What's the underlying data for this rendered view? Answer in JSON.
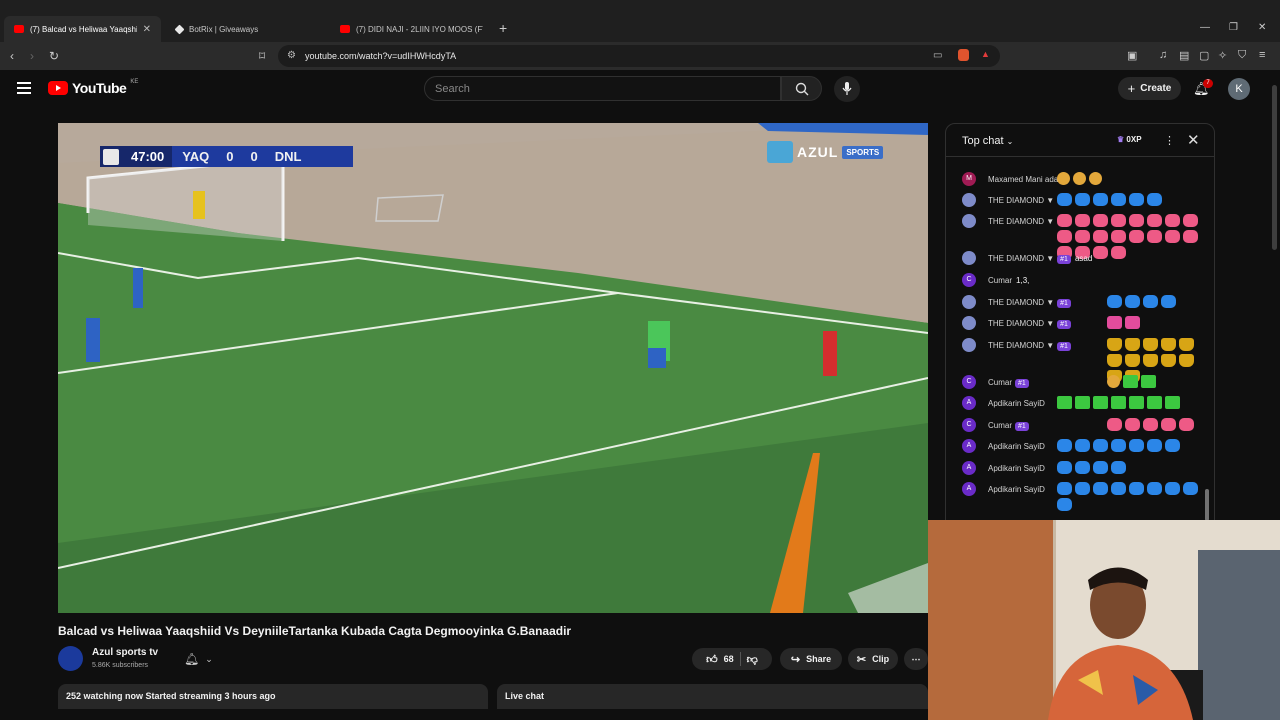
{
  "browser": {
    "tabs": [
      {
        "title": "(7) Balcad vs Heliwaa Yaaqshi",
        "favicon": "youtube-icon"
      },
      {
        "title": "BotRix | Giveaways",
        "favicon": "botrix-icon"
      },
      {
        "title": "(7) DIDI NAJI - 2LIIN IYO MOOS (FT.",
        "favicon": "youtube-icon"
      }
    ],
    "url": "youtube.com/watch?v=udIHWHcdyTA"
  },
  "youtube": {
    "logo_text": "YouTube",
    "country_code": "KE",
    "search_placeholder": "Search",
    "create_label": "Create",
    "notification_count": "7",
    "avatar_letter": "K"
  },
  "video": {
    "scoreboard": {
      "time": "47:00",
      "home": "YAQ",
      "home_score": "0",
      "away_score": "0",
      "away": "DNL"
    },
    "broadcaster_logo": {
      "name": "AZUL",
      "tag": "SPORTS"
    },
    "title": "Balcad vs Heliwaa Yaaqshiid Vs DeyniileTartanka Kubada Cagta Degmooyinka G.Banaadir",
    "channel": {
      "name": "Azul sports tv",
      "subscribers": "5.86K subscribers"
    },
    "likes": "68",
    "share_label": "Share",
    "clip_label": "Clip",
    "stats": "252 watching now  Started streaming 3 hours ago",
    "live_chat_label": "Live chat"
  },
  "chat": {
    "title": "Top chat",
    "xp": "0XP",
    "messages": [
      {
        "author": "Maxamed Mani adan",
        "initial": "M",
        "avatar_color": "#a01b54",
        "badge": "",
        "text": "",
        "emotes": [
          "face",
          "face",
          "face"
        ]
      },
      {
        "author": "THE DIAMOND ▼",
        "initial": "",
        "avatar_color": "#7e8bc9",
        "badge": "",
        "text": "",
        "emotes": [
          "blue",
          "blue",
          "blue",
          "blue",
          "blue",
          "blue"
        ]
      },
      {
        "author": "THE DIAMOND ▼",
        "initial": "",
        "avatar_color": "#7e8bc9",
        "badge": "",
        "text": "",
        "emotes": [
          "pink",
          "pink",
          "pink",
          "pink",
          "pink",
          "pink",
          "pink",
          "pink",
          "pink",
          "pink",
          "pink",
          "pink",
          "pink",
          "pink",
          "pink",
          "pink",
          "pink",
          "pink",
          "pink",
          "pink"
        ]
      },
      {
        "author": "THE DIAMOND ▼",
        "initial": "",
        "avatar_color": "#7e8bc9",
        "badge": "#1",
        "text": "asad",
        "emotes": []
      },
      {
        "author": "Cumar",
        "initial": "C",
        "avatar_color": "#6a2bc8",
        "badge": "",
        "text": "1,3,",
        "emotes": []
      },
      {
        "author": "THE DIAMOND ▼",
        "initial": "",
        "avatar_color": "#7e8bc9",
        "badge": "#1",
        "text": "",
        "emotes": [
          "blue",
          "blue",
          "blue",
          "blue"
        ]
      },
      {
        "author": "THE DIAMOND ▼",
        "initial": "",
        "avatar_color": "#7e8bc9",
        "badge": "#1",
        "text": "",
        "emotes": [
          "pinkface",
          "pinkface"
        ]
      },
      {
        "author": "THE DIAMOND ▼",
        "initial": "",
        "avatar_color": "#7e8bc9",
        "badge": "#1",
        "text": "",
        "emotes": [
          "gold",
          "gold",
          "gold",
          "gold",
          "gold",
          "gold",
          "gold",
          "gold",
          "gold",
          "gold",
          "gold",
          "gold"
        ]
      },
      {
        "author": "Cumar",
        "initial": "C",
        "avatar_color": "#6a2bc8",
        "badge": "#1",
        "text": "",
        "emotes": [
          "face",
          "green",
          "green"
        ]
      },
      {
        "author": "Apdikarin SayiD",
        "initial": "A",
        "avatar_color": "#6a2bc8",
        "badge": "",
        "text": "",
        "emotes": [
          "green",
          "green",
          "green",
          "green",
          "green",
          "green",
          "green"
        ]
      },
      {
        "author": "Cumar",
        "initial": "C",
        "avatar_color": "#6a2bc8",
        "badge": "#1",
        "text": "",
        "emotes": [
          "pink",
          "pink",
          "pink",
          "pink",
          "pink"
        ]
      },
      {
        "author": "Apdikarin SayiD",
        "initial": "A",
        "avatar_color": "#6a2bc8",
        "badge": "",
        "text": "",
        "emotes": [
          "blue",
          "blue",
          "blue",
          "blue",
          "blue",
          "blue",
          "blue"
        ]
      },
      {
        "author": "Apdikarin SayiD",
        "initial": "A",
        "avatar_color": "#6a2bc8",
        "badge": "",
        "text": "",
        "emotes": [
          "blue",
          "blue",
          "blue",
          "blue"
        ]
      },
      {
        "author": "Apdikarin SayiD",
        "initial": "A",
        "avatar_color": "#6a2bc8",
        "badge": "",
        "text": "",
        "emotes": [
          "blue",
          "blue",
          "blue",
          "blue",
          "blue",
          "blue",
          "blue",
          "blue",
          "blue"
        ]
      }
    ]
  }
}
